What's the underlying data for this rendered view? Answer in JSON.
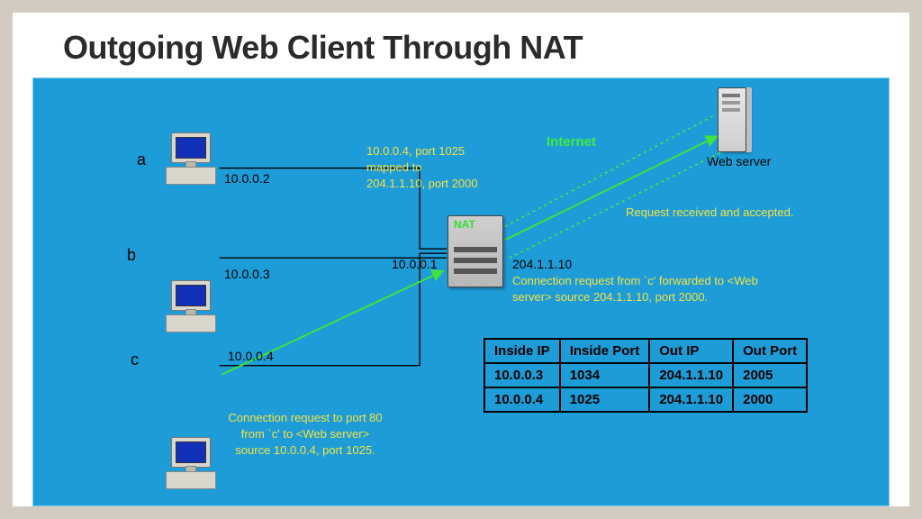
{
  "title": "Outgoing Web Client Through NAT",
  "hosts": {
    "a": {
      "letter": "a",
      "ip": "10.0.0.2"
    },
    "b": {
      "letter": "b",
      "ip": "10.0.0.3"
    },
    "c": {
      "letter": "c",
      "ip": "10.0.0.4"
    }
  },
  "nat": {
    "inside_ip": "10.0.0.1",
    "outside_ip": "204.1.1.10",
    "label": "NAT"
  },
  "internet_label": "Internet",
  "webserver_label": "Web server",
  "mapping_text_l1": "10.0.0.4, port 1025",
  "mapping_text_l2": "mapped to",
  "mapping_text_l3": "204.1.1.10, port 2000",
  "request_accepted": "Request received and accepted.",
  "forward_text": "Connection request from `c' forwarded to <Web server>  source 204.1.1.10, port 2000.",
  "conn_request_l1": "Connection request to port 80",
  "conn_request_l2": "from `c' to <Web server>",
  "conn_request_l3": "source 10.0.0.4, port 1025.",
  "table": {
    "headers": [
      "Inside IP",
      "Inside Port",
      "Out IP",
      "Out Port"
    ],
    "rows": [
      [
        "10.0.0.3",
        "1034",
        "204.1.1.10",
        "2005"
      ],
      [
        "10.0.0.4",
        "1025",
        "204.1.1.10",
        "2000"
      ]
    ]
  },
  "chart_data": {
    "type": "table",
    "title": "NAT translation table",
    "columns": [
      "Inside IP",
      "Inside Port",
      "Out IP",
      "Out Port"
    ],
    "rows": [
      {
        "Inside IP": "10.0.0.3",
        "Inside Port": 1034,
        "Out IP": "204.1.1.10",
        "Out Port": 2005
      },
      {
        "Inside IP": "10.0.0.4",
        "Inside Port": 1025,
        "Out IP": "204.1.1.10",
        "Out Port": 2000
      }
    ],
    "annotations": {
      "nat_inside_ip": "10.0.0.1",
      "nat_outside_ip": "204.1.1.10",
      "client_ips": {
        "a": "10.0.0.2",
        "b": "10.0.0.3",
        "c": "10.0.0.4"
      },
      "request_mapping": {
        "inside": "10.0.0.4:1025",
        "outside": "204.1.1.10:2000",
        "dest_port": 80
      }
    }
  }
}
